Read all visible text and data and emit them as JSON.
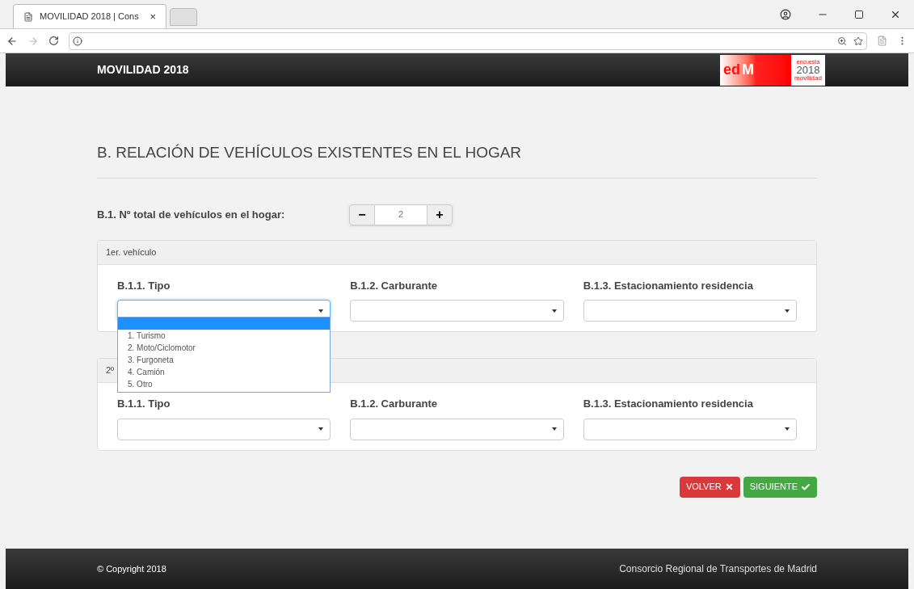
{
  "browser": {
    "tab_title": "MOVILIDAD 2018 | Cons",
    "tab_close": "×"
  },
  "header": {
    "title": "MOVILIDAD 2018",
    "logo": {
      "left": "ed",
      "mark": "M",
      "top": "encuesta",
      "year": "2018",
      "bottom": "movilidad"
    }
  },
  "section_title": "B. RELACIÓN DE VEHÍCULOS EXISTENTES EN EL HOGAR",
  "total": {
    "label": "B.1. Nº total de vehículos en el hogar:",
    "minus": "−",
    "value": "2",
    "plus": "+"
  },
  "vehicles": [
    {
      "title": "1er. vehículo",
      "fields": [
        {
          "label": "B.1.1. Tipo",
          "focused": true,
          "options": [
            "1. Turismo",
            "2. Moto/Ciclomotor",
            "3. Furgoneta",
            "4. Camión",
            "5. Otro"
          ]
        },
        {
          "label": "B.1.2. Carburante",
          "focused": false
        },
        {
          "label": "B.1.3. Estacionamiento residencia",
          "focused": false
        }
      ]
    },
    {
      "title": "2º",
      "fields": [
        {
          "label": "B.1.1. Tipo",
          "focused": false
        },
        {
          "label": "B.1.2. Carburante",
          "focused": false
        },
        {
          "label": "B.1.3. Estacionamiento residencia",
          "focused": false
        }
      ]
    }
  ],
  "buttons": [
    {
      "kind": "back",
      "label": "VOLVER"
    },
    {
      "kind": "next",
      "label": "SIGUIENTE"
    }
  ],
  "footer": {
    "copyright": "© Copyright 2018",
    "org": "Consorcio Regional de Transportes de Madrid"
  }
}
